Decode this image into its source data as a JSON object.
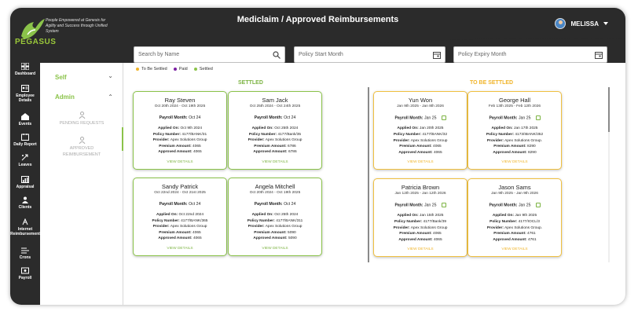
{
  "app": {
    "brand": "PEGASUS",
    "tagline": "People Empowered at Genesis for Agility and Success through Unified System",
    "page_title": "Mediclaim / Approved Reimbursements",
    "user_name": "MELISSA"
  },
  "sidebar": [
    {
      "label": "Dashboard",
      "icon": "dashboard-icon"
    },
    {
      "label": "Employee Details",
      "icon": "id-card-icon"
    },
    {
      "label": "Events",
      "icon": "events-icon"
    },
    {
      "label": "Daily Report",
      "icon": "report-icon"
    },
    {
      "label": "Leaves",
      "icon": "leaves-icon"
    },
    {
      "label": "Appraisal",
      "icon": "appraisal-icon"
    },
    {
      "label": "Clients",
      "icon": "clients-icon"
    },
    {
      "label": "Internet Reimbursement",
      "icon": "internet-icon"
    },
    {
      "label": "Crons",
      "icon": "crons-icon"
    },
    {
      "label": "Payroll",
      "icon": "payroll-icon"
    }
  ],
  "submenu": {
    "self_label": "Self",
    "admin_label": "Admin",
    "pending_label_1": "PENDING REQUESTS",
    "approved_label_1": "APPROVED",
    "approved_label_2": "REIMBURSEMENT"
  },
  "filters": {
    "search_placeholder": "Search by Name",
    "start_placeholder": "Policy Start Month",
    "expiry_placeholder": "Policy Expiry Month"
  },
  "legend": [
    {
      "label": "To Be Settled",
      "color": "#f0b429"
    },
    {
      "label": "Paid",
      "color": "#7b1fa2"
    },
    {
      "label": "Settled",
      "color": "#8bc34a"
    }
  ],
  "sections": {
    "settled_title": "SETTLED",
    "tbs_title": "TO BE SETTLED"
  },
  "labels": {
    "payroll_month": "Payroll Month:",
    "applied_on": "Applied On:",
    "policy_number": "Policy Number:",
    "provider": "Provider:",
    "premium_amount": "Premium Amount:",
    "approved_amount": "Approved Amount:",
    "view_details": "VIEW DETAILS"
  },
  "settled_cards": [
    {
      "name": "Ray Steven",
      "dates": "Oct 20th 2024 - Oct 19th 2025",
      "payroll": "Oct 24",
      "applied": "Oct 9th 2024",
      "policy": "4177/BANK/31",
      "provider": "Apex Solutions Group",
      "premium": "4065",
      "approved": "4065"
    },
    {
      "name": "Sam Jack",
      "dates": "Oct 25th 2024 - Oct 24th 2025",
      "payroll": "Oct 24",
      "applied": "Oct 25th 2024",
      "policy": "4177/Bank/35",
      "provider": "Apex Solutions Group",
      "premium": "6786",
      "approved": "6786"
    },
    {
      "name": "Sandy Patrick",
      "dates": "Oct 22nd 2024 - Oct 21st 2025",
      "payroll": "Oct 24",
      "applied": "Oct 22nd 2024",
      "policy": "4177/BANK/365",
      "provider": "Apex Solutions Group",
      "premium": "4065",
      "approved": "4065"
    },
    {
      "name": "Angela Mitchell",
      "dates": "Oct 20th 2024 - Oct 19th 2025",
      "payroll": "Oct 24",
      "applied": "Oct 25th 2024",
      "policy": "4177/BANK/311",
      "provider": "Apex Solutions Group",
      "premium": "5090",
      "approved": "5090"
    }
  ],
  "pending_cards": [
    {
      "name": "Yun Won",
      "dates": "Jan 9th 2025 - Jan 8th 2026",
      "payroll": "Jan 25",
      "applied": "Jan 20th 2025",
      "policy": "4177/BANK/32",
      "provider": "Apex Solutions Group",
      "premium": "4065",
      "approved": "4065"
    },
    {
      "name": "George Hall",
      "dates": "Feb 13th 2025 - Feb 12th 2026",
      "payroll": "Jan 25",
      "applied": "Jan 17th 2025",
      "policy": "4173/IBANK/352",
      "provider": "Apex Solutions Group.",
      "premium": "8290",
      "approved": "8290"
    },
    {
      "name": "Patricia Brown",
      "dates": "Jan 12th 2025 - Jan 12th 2026",
      "payroll": "Jan 25",
      "applied": "Jan 15th 2025",
      "policy": "4177/Bank/39",
      "provider": "Apex Solutions Group",
      "premium": "4065",
      "approved": "4065"
    },
    {
      "name": "Jason Sams",
      "dates": "Jan 9th 2025 - Jan 9th 2026",
      "payroll": "Jan 25",
      "applied": "Jan 9th 2025",
      "policy": "4177/IOCL/3",
      "provider": "Apex Solutions Group.",
      "premium": "4761",
      "approved": "4761"
    }
  ]
}
